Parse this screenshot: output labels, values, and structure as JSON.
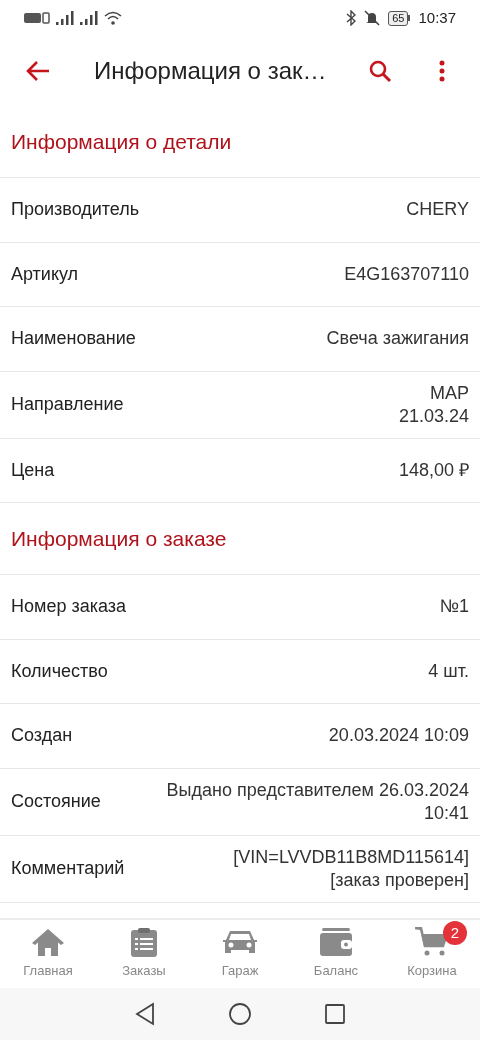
{
  "status_bar": {
    "battery": "65",
    "time": "10:37"
  },
  "app_bar": {
    "title": "Информация о зак…"
  },
  "sections": [
    {
      "title": "Информация о детали",
      "rows": [
        {
          "label": "Производитель",
          "value_lines": [
            "CHERY"
          ]
        },
        {
          "label": "Артикул",
          "value_lines": [
            "E4G163707110"
          ]
        },
        {
          "label": "Наименование",
          "value_lines": [
            "Свеча зажигания"
          ]
        },
        {
          "label": "Направление",
          "value_lines": [
            "МАР",
            "21.03.24"
          ]
        },
        {
          "label": "Цена",
          "value_lines": [
            "148,00 ₽"
          ]
        }
      ]
    },
    {
      "title": "Информация о заказе",
      "rows": [
        {
          "label": "Номер заказа",
          "value_lines": [
            "№1"
          ]
        },
        {
          "label": "Количество",
          "value_lines": [
            "4 шт."
          ]
        },
        {
          "label": "Создан",
          "value_lines": [
            "20.03.2024 10:09"
          ]
        },
        {
          "label": "Состояние",
          "value_lines": [
            "Выдано представителем 26.03.2024",
            "10:41"
          ]
        },
        {
          "label": "Комментарий",
          "value_lines": [
            "[VIN=LVVDB11B8MD115614]",
            "[заказ проверен]"
          ]
        }
      ]
    }
  ],
  "bottom_nav": [
    {
      "kind": "home",
      "label": "Главная"
    },
    {
      "kind": "orders",
      "label": "Заказы"
    },
    {
      "kind": "garage",
      "label": "Гараж"
    },
    {
      "kind": "balance",
      "label": "Баланс"
    },
    {
      "kind": "cart",
      "label": "Корзина",
      "badge": "2"
    }
  ]
}
